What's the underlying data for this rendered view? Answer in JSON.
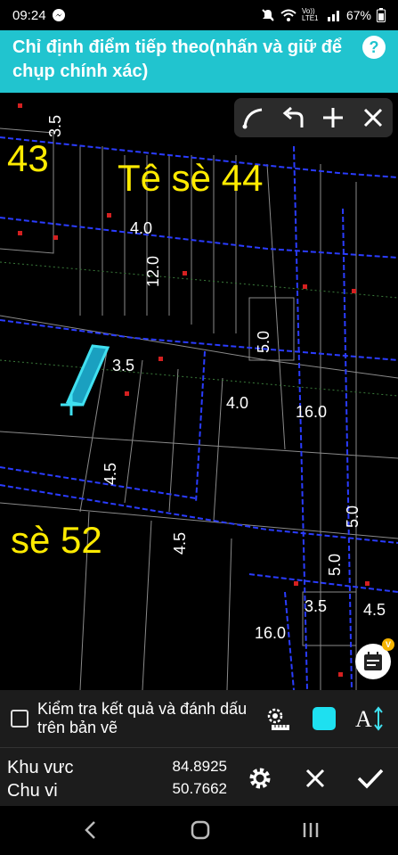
{
  "status_bar": {
    "time": "09:24",
    "network": "Vo)) LTE1",
    "battery": "67%"
  },
  "header": {
    "title": "Chỉ định điểm tiếp theo(nhấn và giữ để chụp chính xác)",
    "help_label": "?"
  },
  "toolbar": {
    "tools": [
      "arc-icon",
      "undo-icon",
      "plus-icon",
      "close-icon"
    ]
  },
  "map": {
    "labels": {
      "lot_43": "43",
      "alley_44": "Tê sè 44",
      "alley_52": "sè 52"
    },
    "dimensions": {
      "d1": "3.5",
      "d2": "4.0",
      "d3": "12.0",
      "d4": "3.5",
      "d5": "5.0",
      "d6": "4.0",
      "d7": "16.0",
      "d8": "4.5",
      "d9": "4.5",
      "d10": "5.0",
      "d11": "5.0",
      "d12": "3.5",
      "d13": "4.5",
      "d14": "16.0"
    },
    "badge": "V"
  },
  "options": {
    "check_label": "Kiểm tra kết quả và đánh dấu trên bản vẽ",
    "checked": false,
    "fill_color": "#1ee0f0"
  },
  "results": {
    "area_label": "Khu vưc",
    "area_value": "84.8925",
    "perimeter_label": "Chu vi",
    "perimeter_value": "50.7662"
  }
}
